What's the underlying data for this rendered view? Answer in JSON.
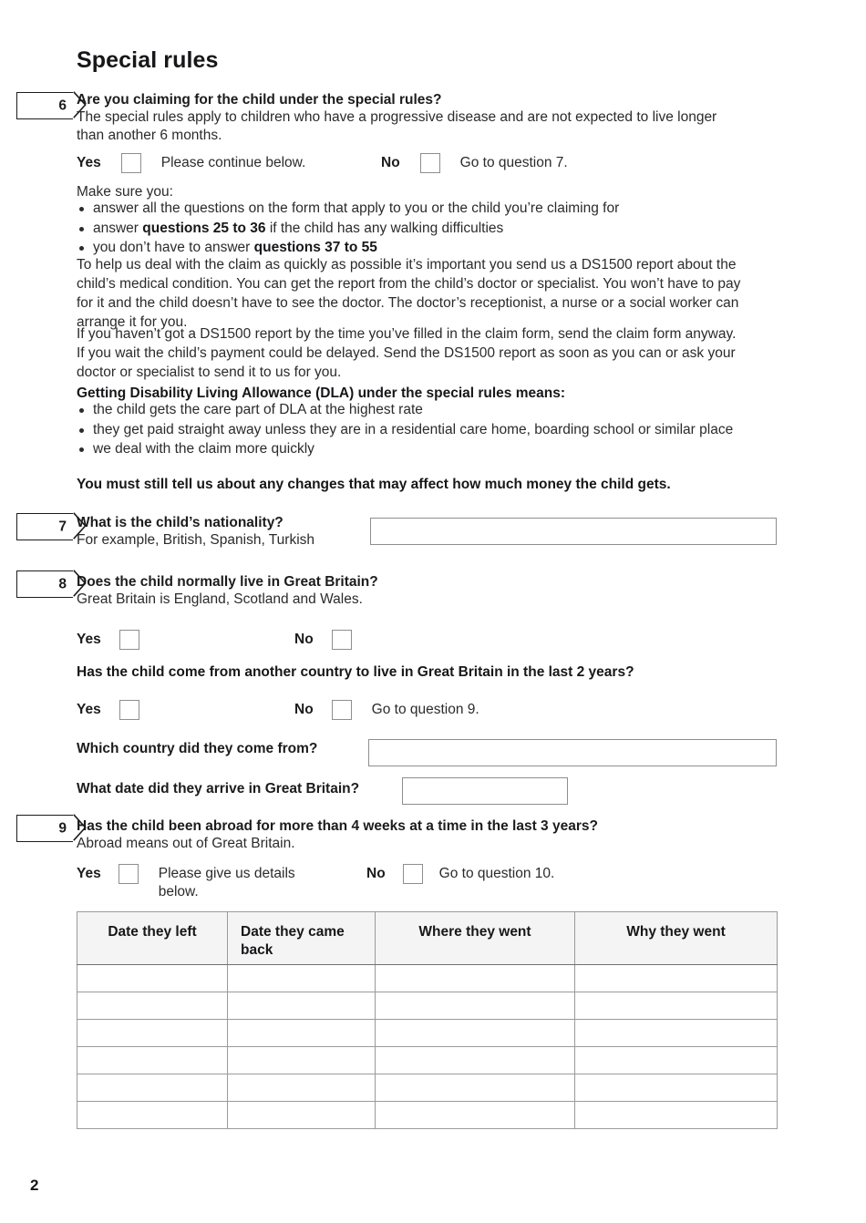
{
  "page": {
    "section_heading": "Special rules",
    "page_number": "2"
  },
  "questions": [
    {
      "number": "6",
      "title": "Are you claiming for the child under the special rules?",
      "subtitle": "The special rules apply to children who have a progressive disease and are not expected to live longer than another 6 months.",
      "yes_label": "Yes",
      "yes_note": "Please continue below.",
      "no_label": "No",
      "no_note": "Go to question 7.",
      "make_sure_intro": "Make sure you:",
      "make_sure_bullets": [
        {
          "pre": "answer all the questions on the form that apply to you or the child you’re claiming for",
          "bold": "",
          "post": ""
        },
        {
          "pre": "answer ",
          "bold": "questions 25 to 36",
          "post": " if the child has any walking difficulties"
        },
        {
          "pre": "you don’t have to answer ",
          "bold": "questions 37 to 55",
          "post": ""
        }
      ],
      "ds1500_para_1": "To help us deal with the claim as quickly as possible it’s important you send us a DS1500 report about the child’s medical condition. You can get the report from the child’s doctor or specialist. You won’t have to pay for it and the child doesn’t have to see the doctor. The doctor’s receptionist, a nurse or a social worker can arrange it for you.",
      "ds1500_para_2": "If you haven’t got a DS1500 report by the time you’ve filled in the claim form, send the claim form anyway. If you wait the child’s payment could be delayed. Send the DS1500 report as soon as you can or ask your doctor or specialist to send it to us for you.",
      "dla_heading": "Getting Disability Living Allowance (DLA) under the special rules means:",
      "dla_bullets": [
        "the child gets the care part of DLA at the highest rate",
        "they get paid straight away unless they are in a residential care home, boarding school or similar place",
        "we deal with the claim more quickly"
      ],
      "closing_bold": "You must still tell us about any changes that may affect how much money the child gets."
    },
    {
      "number": "7",
      "title": "What is the child’s nationality?",
      "subtitle": "For example, British, Spanish, Turkish",
      "field_value": "",
      "field_placeholder": ""
    },
    {
      "number": "8",
      "title": "Does the child normally live in Great Britain?",
      "subtitle": "Great Britain is England, Scotland and Wales.",
      "yes_label": "Yes",
      "no_label": "No",
      "sub_question": "Has the child come from another country to live in Great Britain in the last 2 years?",
      "sub_yes_label": "Yes",
      "sub_no_label": "No",
      "sub_no_note": "Go to question 9.",
      "country_label": "Which country did they come from?",
      "country_value": "",
      "country_placeholder": "",
      "arrival_label": "What date did they arrive in Great Britain?",
      "arrival_value": "",
      "arrival_placeholder": ""
    },
    {
      "number": "9",
      "title": "Has the child been abroad for more than 4 weeks at a time in the last 3 years?",
      "subtitle": "Abroad means out of Great Britain.",
      "yes_label": "Yes",
      "yes_note": "Please give us details below.",
      "no_label": "No",
      "no_note": "Go to question 10."
    }
  ],
  "travel_table": {
    "columns": [
      "Date they left",
      "Date they came back",
      "Where they went",
      "Why they went"
    ],
    "rows": [
      [
        "",
        "",
        "",
        ""
      ],
      [
        "",
        "",
        "",
        ""
      ],
      [
        "",
        "",
        "",
        ""
      ],
      [
        "",
        "",
        "",
        ""
      ],
      [
        "",
        "",
        "",
        ""
      ],
      [
        "",
        "",
        "",
        ""
      ]
    ]
  }
}
